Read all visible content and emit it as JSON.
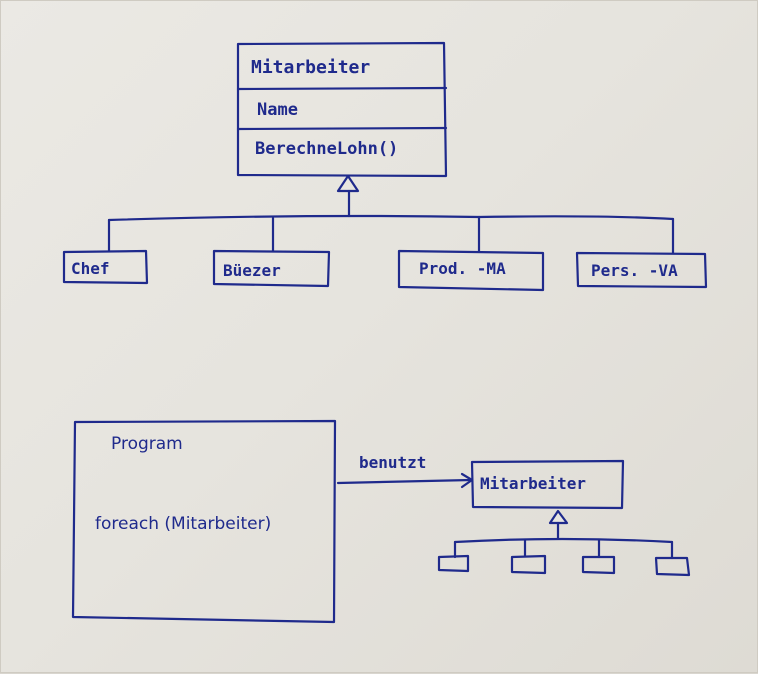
{
  "uml_class": {
    "name": "Mitarbeiter",
    "attribute": "Name",
    "method": "BerechneLohn()"
  },
  "subclasses": [
    "Chef",
    "Büezer",
    "Prod. -MA",
    "Pers. -VA"
  ],
  "program_box": {
    "title": "Program",
    "code": "foreach (Mitarbeiter)"
  },
  "relation": {
    "label": "benutzt"
  },
  "small_class": {
    "name": "Mitarbeiter"
  },
  "colors": {
    "ink": "#1f2a8c",
    "paper": "#e8e6e0"
  }
}
